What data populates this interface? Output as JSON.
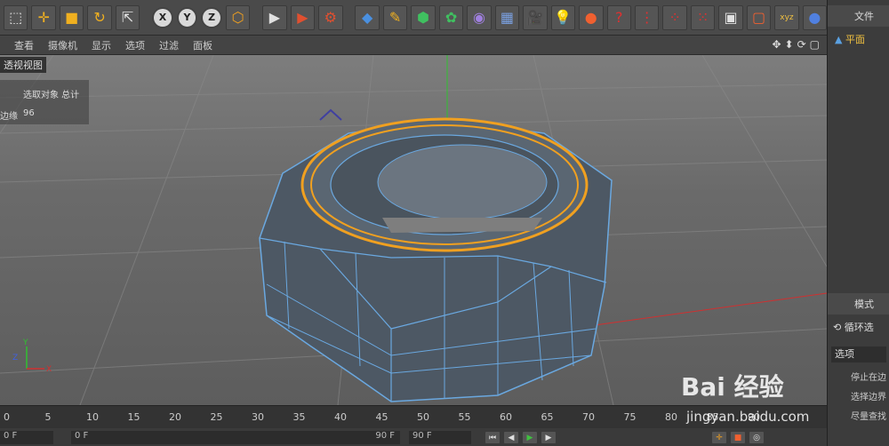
{
  "toolbar": {
    "icons": [
      "select-icon",
      "move-icon",
      "scale-icon",
      "rotate-icon",
      "coord-icon",
      "x-axis",
      "y-axis",
      "z-axis",
      "world-icon",
      "render-view-icon",
      "render-icon",
      "render-settings-icon",
      "cube-icon",
      "pen-icon",
      "subdivision-icon",
      "cloner-icon",
      "deformer-icon",
      "floor-icon",
      "camera-icon",
      "light-icon",
      "tag-icon"
    ],
    "axis_labels": [
      "X",
      "Y",
      "Z"
    ]
  },
  "menu": {
    "items": [
      "查看",
      "摄像机",
      "显示",
      "选项",
      "过滤",
      "面板"
    ]
  },
  "viewport": {
    "label": "透视视图",
    "hud_row1": "选取对象  总计",
    "hud_row2_label": "边缘",
    "hud_row2_value": "96"
  },
  "right_panel": {
    "tab_file": "文件",
    "object_name": "平面",
    "tab_mode": "模式",
    "tool_name": "循环选",
    "options_label": "选项",
    "option_lines": [
      "停止在边",
      "选择边界",
      "尽量查找"
    ]
  },
  "timeline": {
    "ticks": [
      "0",
      "5",
      "10",
      "15",
      "20",
      "25",
      "30",
      "35",
      "40",
      "45",
      "50",
      "55",
      "60",
      "65",
      "70",
      "75",
      "80",
      "85",
      "90"
    ]
  },
  "bottom": {
    "field1": "0 F",
    "field2": "0 F",
    "field3": "90 F",
    "field4": "90 F"
  },
  "watermark": {
    "brand": "Bai 经验",
    "url": "jingyan.baidu.com"
  },
  "colors": {
    "selection": "#f0a020",
    "mesh_edge": "#6aa8e0",
    "mesh_face": "#4a5560"
  }
}
